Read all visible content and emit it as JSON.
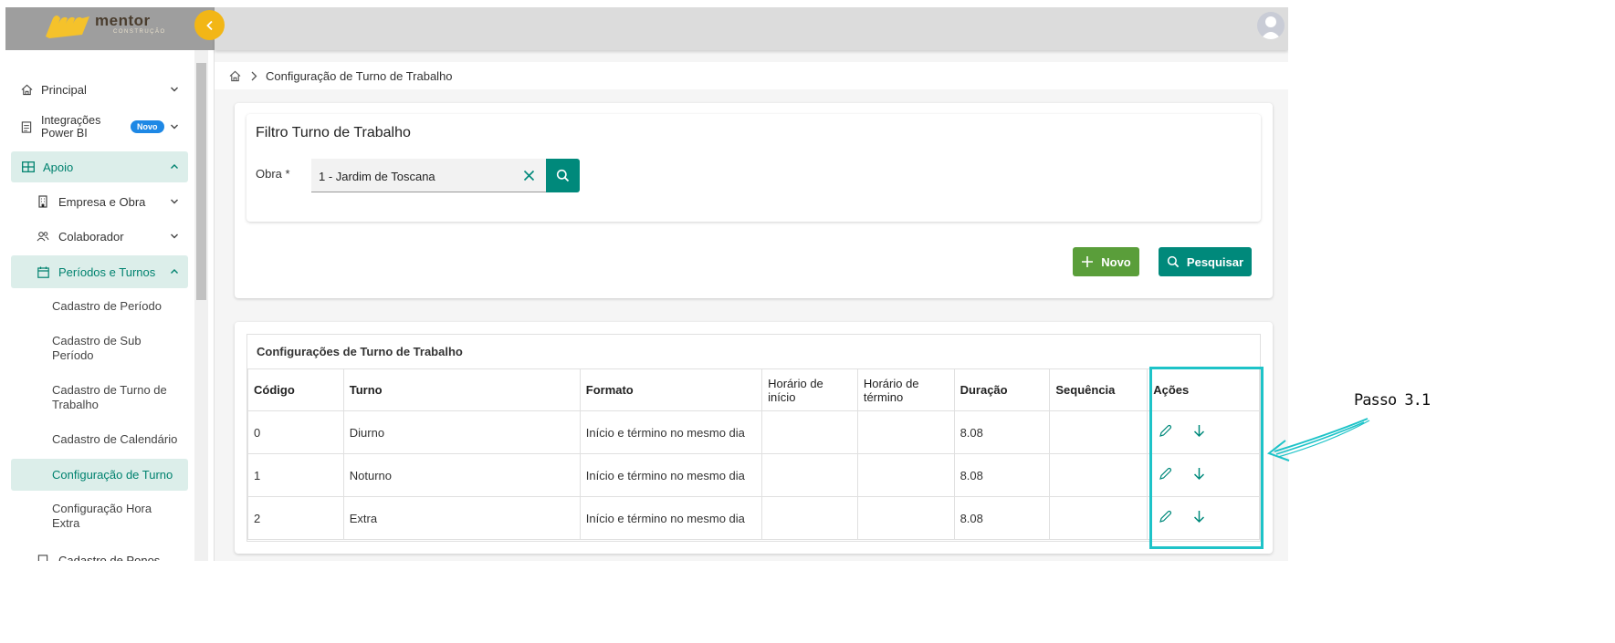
{
  "app": {
    "logo_text": "mentor",
    "logo_sub": "CONSTRUÇÃO"
  },
  "sidebar": {
    "items": [
      {
        "label": "Principal",
        "icon": "home-icon"
      },
      {
        "label": "Integrações\nPower BI",
        "icon": "document-icon",
        "badge": "Novo"
      },
      {
        "label": "Apoio",
        "icon": "grid-icon"
      },
      {
        "label": "Empresa e Obra",
        "icon": "building-icon"
      },
      {
        "label": "Colaborador",
        "icon": "people-icon"
      },
      {
        "label": "Períodos e Turnos",
        "icon": "calendar-icon"
      }
    ],
    "sub_items": [
      "Cadastro de Período",
      "Cadastro de Sub\nPeríodo",
      "Cadastro de Turno de\nTrabalho",
      "Cadastro de Calendário",
      "Configuração de Turno",
      "Configuração Hora\nExtra"
    ],
    "cut_item": "Cadastro de Ponos"
  },
  "breadcrumb": {
    "current": "Configuração de Turno de Trabalho"
  },
  "filter": {
    "title": "Filtro Turno de Trabalho",
    "obra_label": "Obra *",
    "obra_value": "1 - Jardim de Toscana"
  },
  "actions": {
    "novo_label": "Novo",
    "pesquisar_label": "Pesquisar"
  },
  "table": {
    "title": "Configurações de Turno de Trabalho",
    "columns": [
      "Código",
      "Turno",
      "Formato",
      "Horário de\ninício",
      "Horário de\ntérmino",
      "Duração",
      "Sequência",
      "Ações"
    ],
    "rows": [
      {
        "codigo": "0",
        "turno": "Diurno",
        "formato": "Início e término no mesmo dia",
        "inicio": "",
        "termino": "",
        "duracao": "8.08",
        "sequencia": ""
      },
      {
        "codigo": "1",
        "turno": "Noturno",
        "formato": "Início e término no mesmo dia",
        "inicio": "",
        "termino": "",
        "duracao": "8.08",
        "sequencia": ""
      },
      {
        "codigo": "2",
        "turno": "Extra",
        "formato": "Início e término no mesmo dia",
        "inicio": "",
        "termino": "",
        "duracao": "8.08",
        "sequencia": ""
      }
    ]
  },
  "annotation": {
    "label": "Passo 3.1",
    "color": "#1ec3c8"
  },
  "colors": {
    "primary": "#00897b",
    "novo": "#5a9e3a",
    "accent_yellow": "#f2b616",
    "active_bg": "#dceeea"
  }
}
